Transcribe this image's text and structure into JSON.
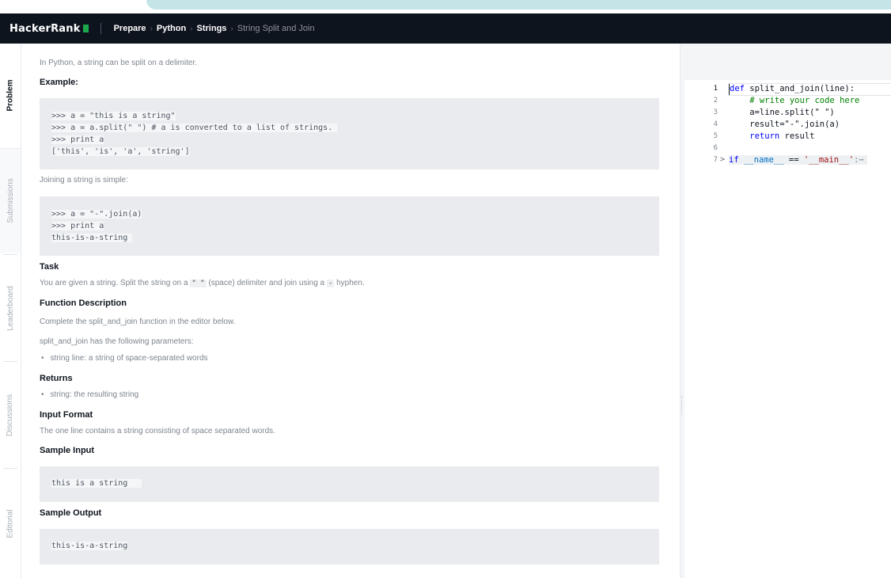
{
  "navbar": {
    "logo_text": "HackerRank",
    "breadcrumbs": [
      "Prepare",
      "Python",
      "Strings"
    ],
    "current_page": "String Split and Join"
  },
  "sidetabs": [
    "Problem",
    "Submissions",
    "Leaderboard",
    "Discussions",
    "Editorial"
  ],
  "problem": {
    "intro": "In Python, a string can be split on a delimiter.",
    "example_heading": "Example:",
    "example_code": [
      ">>> a = \"this is a string\"",
      ">>> a = a.split(\" \") # a is converted to a list of strings. ",
      ">>> print a",
      "['this', 'is', 'a', 'string']"
    ],
    "join_text": "Joining a string is simple:",
    "join_code": [
      ">>> a = \"-\".join(a)",
      ">>> print a",
      "this-is-a-string "
    ],
    "task_heading": "Task",
    "task_text_1": "You are given a string. Split the string on a",
    "task_code_1": "\" \"",
    "task_text_2": "(space) delimiter and join using a",
    "task_code_2": "-",
    "task_text_3": "hyphen.",
    "func_heading": "Function Description",
    "func_text": "Complete the split_and_join function in the editor below.",
    "params_text": "split_and_join has the following parameters:",
    "params_bullet": "string line: a string of space-separated words",
    "returns_heading": "Returns",
    "returns_bullet": "string: the resulting string",
    "input_heading": "Input Format",
    "input_text": "The one line contains a string consisting of space separated words.",
    "sample_input_heading": "Sample Input",
    "sample_input": "this is a string   ",
    "sample_output_heading": "Sample Output",
    "sample_output": "this-is-a-string"
  },
  "editor": {
    "line_numbers": [
      "1",
      "2",
      "3",
      "4",
      "5",
      "6",
      "7"
    ],
    "line1_kw": "def",
    "line1_rest": " split_and_join(line):",
    "line2": "    # write your code here",
    "line3": "    a=line.split(\" \")",
    "line4": "    result=\"-\".join(a)",
    "line5_kw": "    return",
    "line5_rest": " result",
    "line7_kw": "if",
    "line7_name": " __name__",
    "line7_op": " ==",
    "line7_str": " '__main__'",
    "line7_tail": ":⋯",
    "fold_chevron": ">"
  }
}
